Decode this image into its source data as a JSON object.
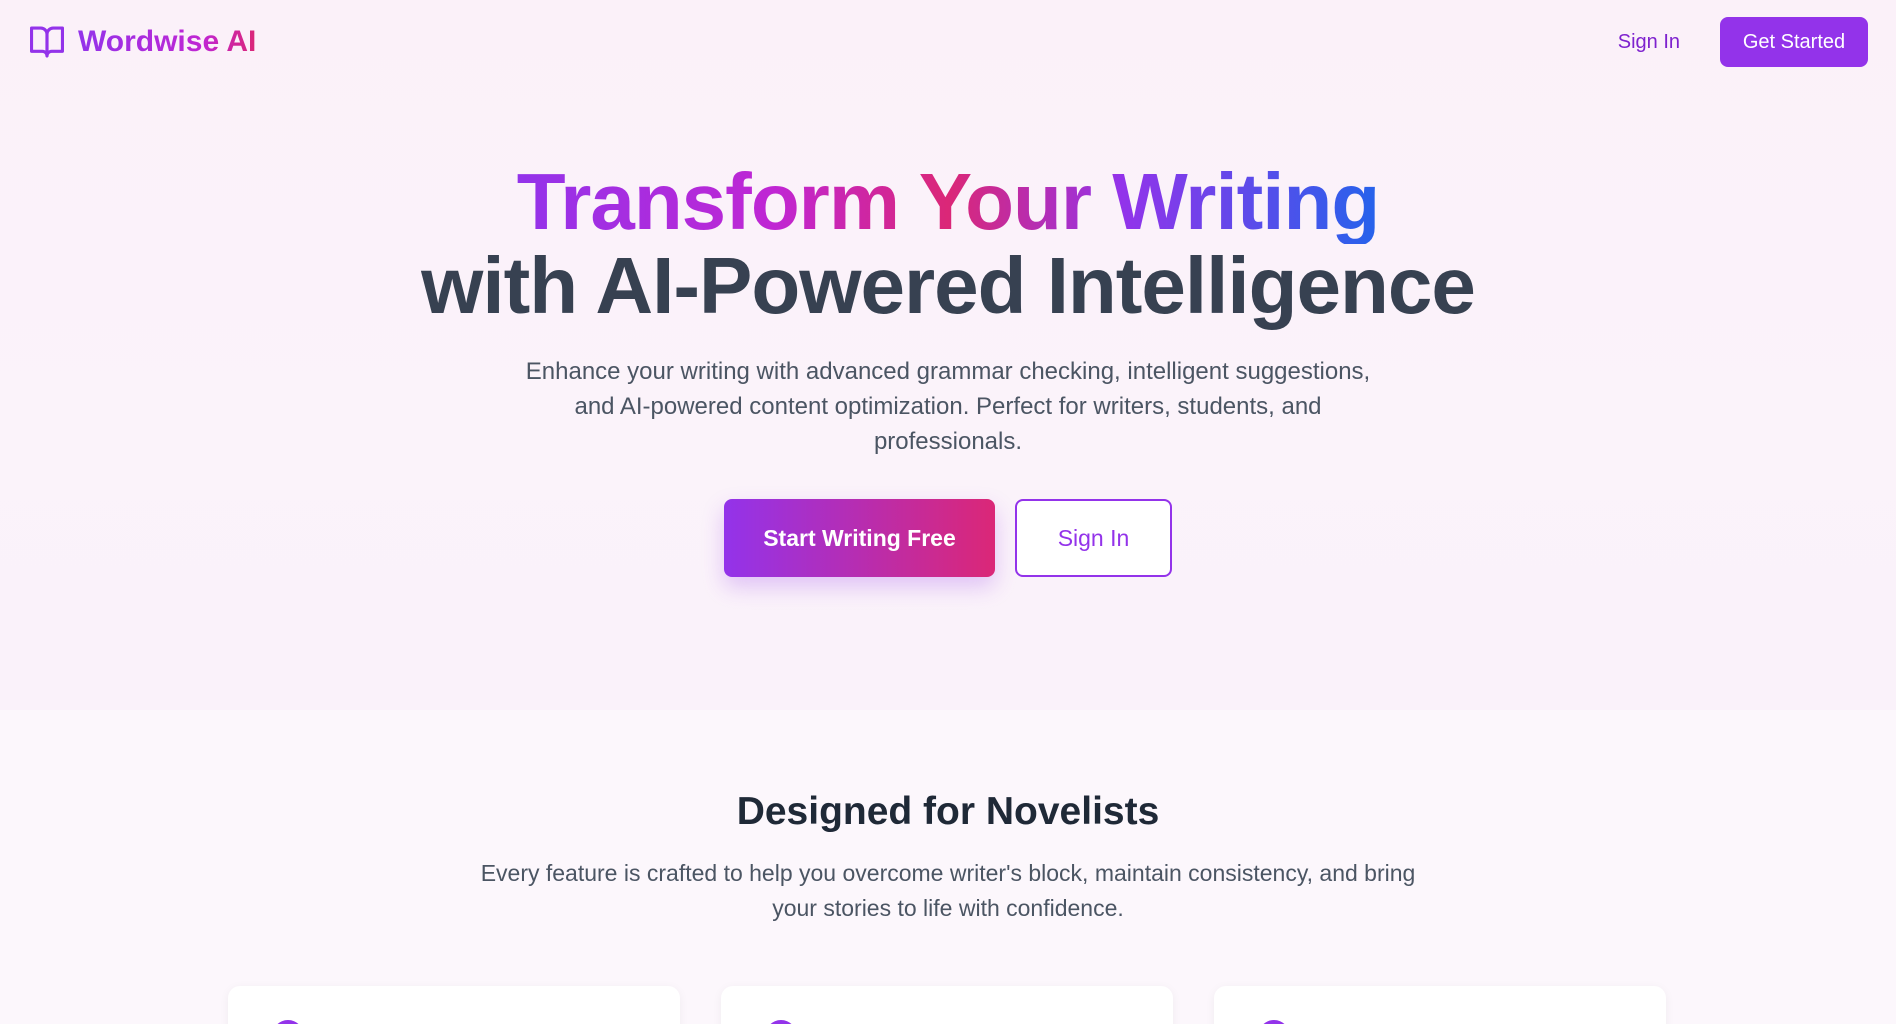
{
  "nav": {
    "brand": "Wordwise AI",
    "signin_label": "Sign In",
    "cta_label": "Get Started"
  },
  "hero": {
    "title_line1": "Transform Your Writing",
    "title_line2": "with AI-Powered Intelligence",
    "subtitle": "Enhance your writing with advanced grammar checking, intelligent suggestions, and AI-powered content optimization. Perfect for writers, students, and professionals.",
    "primary_button": "Start Writing Free",
    "secondary_button": "Sign In"
  },
  "features": {
    "title": "Designed for Novelists",
    "subtitle": "Every feature is crafted to help you overcome writer's block, maintain consistency, and bring your stories to life with confidence."
  },
  "colors": {
    "accent": "#9333ea",
    "accent_pink": "#db2777",
    "accent_blue": "#2563eb",
    "heading": "#374151"
  },
  "icons": {
    "brand": "open-book-icon"
  }
}
